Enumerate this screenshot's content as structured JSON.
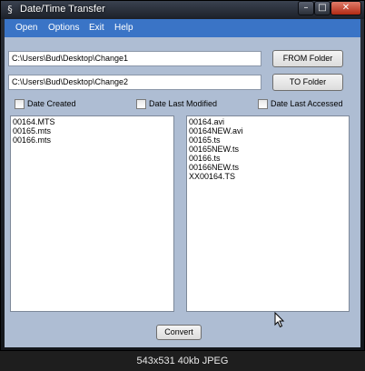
{
  "window": {
    "title": "Date/Time Transfer",
    "minimize_glyph": "–",
    "maximize_glyph": "□",
    "close_glyph": "✕"
  },
  "menu": {
    "items": [
      "Open",
      "Options",
      "Exit",
      "Help"
    ]
  },
  "from": {
    "path": "C:\\Users\\Bud\\Desktop\\Change1",
    "button": "FROM Folder"
  },
  "to": {
    "path": "C:\\Users\\Bud\\Desktop\\Change2",
    "button": "TO Folder"
  },
  "options": {
    "date_created": {
      "label": "Date Created",
      "checked": false
    },
    "date_modified": {
      "label": "Date Last Modified",
      "checked": false
    },
    "date_accessed": {
      "label": "Date Last Accessed",
      "checked": false
    }
  },
  "left_list": [
    "00164.MTS",
    "00165.mts",
    "00166.mts"
  ],
  "right_list": [
    "00164.avi",
    "00164NEW.avi",
    "00165.ts",
    "00165NEW.ts",
    "00166.ts",
    "00166NEW.ts",
    "XX00164.TS"
  ],
  "convert_button": "Convert",
  "caption": "543x531 40kb JPEG",
  "colors": {
    "client": "#aebdd3",
    "menubar": "#3a74c6",
    "close": "#c8402a"
  },
  "icons": {
    "app": "app-icon",
    "cursor": "mouse-cursor-icon"
  }
}
